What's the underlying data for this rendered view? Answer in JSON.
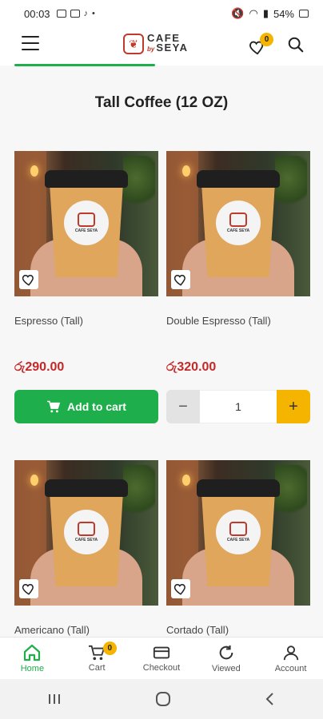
{
  "status_bar": {
    "time": "00:03",
    "battery": "54%"
  },
  "header": {
    "logo_top": "CAFE",
    "logo_by": "by",
    "logo_bottom": "SEYA",
    "wishlist_count": "0"
  },
  "page": {
    "title": "Tall Coffee (12 OZ)"
  },
  "products": [
    {
      "name": "Espresso (Tall)",
      "price": "රු290.00",
      "action": "Add to cart"
    },
    {
      "name": "Double Espresso (Tall)",
      "price": "රු320.00",
      "quantity": "1",
      "minus": "−",
      "plus": "+"
    },
    {
      "name": "Americano (Tall)"
    },
    {
      "name": "Cortado (Tall)"
    }
  ],
  "sticker_text": "CAFE SEYA",
  "bottom_nav": [
    {
      "label": "Home",
      "active": true
    },
    {
      "label": "Cart",
      "count": "0"
    },
    {
      "label": "Checkout"
    },
    {
      "label": "Viewed"
    },
    {
      "label": "Account"
    }
  ],
  "colors": {
    "accent": "#1fae4c",
    "badge": "#f5b400",
    "price": "#c62828"
  },
  "icons": [
    "menu-icon",
    "heart-icon",
    "search-icon",
    "cart-icon",
    "home-icon",
    "checkout-card-icon",
    "viewed-refresh-icon",
    "account-icon"
  ]
}
